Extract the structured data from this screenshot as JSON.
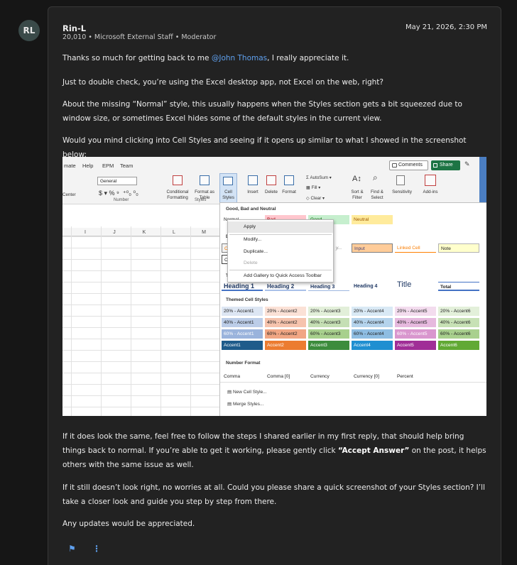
{
  "avatar": {
    "initials": "RL"
  },
  "post": {
    "author": "Rin-L",
    "meta": "20,010 • Microsoft External Staff • Moderator",
    "date": "May 21, 2026, 2:30 PM",
    "p1_pre": "Thanks so much for getting back to me ",
    "p1_mention": "@John Thomas",
    "p1_post": ", I really appreciate it.",
    "p2": "Just to double check, you’re using the Excel desktop app, not Excel on the web, right?",
    "p3": "About the missing “Normal” style, this usually happens when the Styles section gets a bit squeezed due to window size, or sometimes Excel hides some of the default styles in the current view.",
    "p4": "Would you mind clicking into Cell Styles and seeing if it opens up similar to what I showed in the screenshot below:",
    "p5_pre": "If it does look the same, feel free to follow the steps I shared earlier in my first reply, that should help bring things back to normal. If you’re able to get it working, please gently click ",
    "p5_bold": "“Accept Answer”",
    "p5_post": " on the post, it helps others with the same issue as well.",
    "p6": "If it still doesn’t look right, no worries at all. Could you please share a quick screenshot of your Styles section? I’ll take a closer look and guide you step by step from there.",
    "p7": "Any updates would be appreciated."
  },
  "screenshot": {
    "menu": [
      "mate",
      "Help",
      "EPM",
      "Team"
    ],
    "comments_label": "Comments",
    "share_label": "Share",
    "number_format": "General",
    "center_label": "Center",
    "ribbon_buttons": {
      "conditional": "Conditional Formatting",
      "format_table": "Format as Table",
      "cell_styles": "Cell Styles",
      "insert": "Insert",
      "delete": "Delete",
      "format": "Format",
      "autosum": "AutoSum",
      "fill": "Fill",
      "clear": "Clear",
      "sort": "Sort & Filter",
      "find": "Find & Select",
      "sensitivity": "Sensitivity",
      "addins": "Add-ins"
    },
    "groups": {
      "number": "Number",
      "styles": "Styles"
    },
    "columns": [
      "I",
      "J",
      "K",
      "L",
      "M"
    ],
    "gallery": {
      "good_bad_title": "Good, Bad and Neutral",
      "normal": "Normal",
      "bad": "Bad",
      "good": "Good",
      "neutral": "Neutral",
      "data_model_partial": "D",
      "calc_partial": "Ca",
      "output_partial": "Ou",
      "explanatory_partial": "y...",
      "input": "Input",
      "linked_cell": "Linked Cell",
      "note": "Note",
      "titles_partial": "Ti",
      "heading1": "Heading 1",
      "heading2": "Heading 2",
      "heading3": "Heading 3",
      "heading4": "Heading 4",
      "title": "Title",
      "total": "Total",
      "themed_title": "Themed Cell Styles",
      "row20": [
        "20% - Accent1",
        "20% - Accent2",
        "20% - Accent3",
        "20% - Accent4",
        "20% - Accent5",
        "20% - Accent6"
      ],
      "row40": [
        "40% - Accent1",
        "40% - Accent2",
        "40% - Accent3",
        "40% - Accent4",
        "40% - Accent5",
        "40% - Accent6"
      ],
      "row60": [
        "60% - Accent1",
        "60% - Accent2",
        "60% - Accent3",
        "60% - Accent4",
        "60% - Accent5",
        "60% - Accent6"
      ],
      "rowAcc": [
        "Accent1",
        "Accent2",
        "Accent3",
        "Accent4",
        "Accent5",
        "Accent6"
      ],
      "number_title": "Number Format",
      "numfmt": [
        "Comma",
        "Comma [0]",
        "Currency",
        "Currency [0]",
        "Percent"
      ],
      "new_cell_style": "New Cell Style...",
      "merge_styles": "Merge Styles..."
    },
    "context_menu": {
      "apply": "Apply",
      "modify": "Modify...",
      "duplicate": "Duplicate...",
      "delete": "Delete",
      "add_qat": "Add Gallery to Quick Access Toolbar"
    }
  },
  "colors": {
    "mention": "#5fa0ee",
    "card_bg": "#222222",
    "share_green": "#1d7444"
  }
}
